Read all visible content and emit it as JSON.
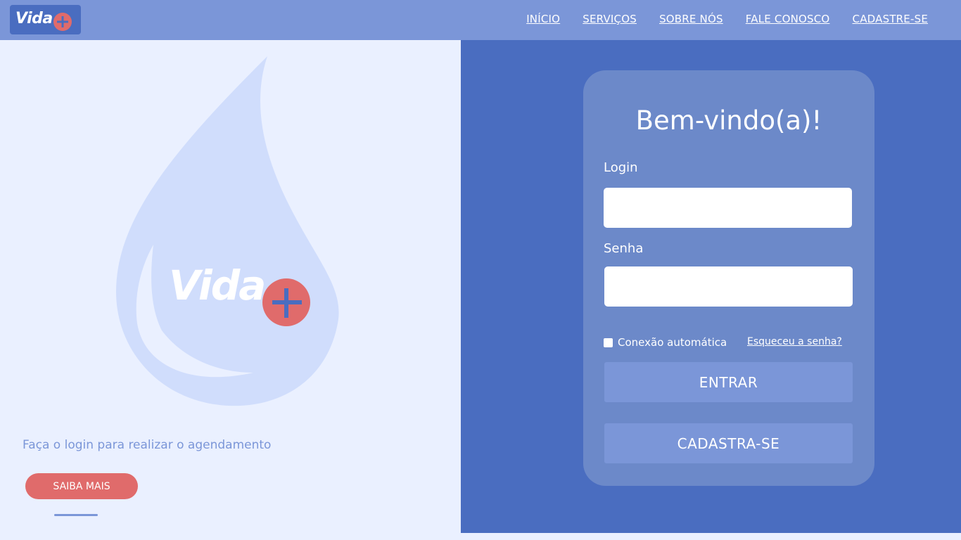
{
  "header": {
    "logo_text": "Vida",
    "nav": [
      "INÍCIO",
      "SERVIÇOS",
      "SOBRE NÓS",
      "FALE CONOSCO",
      "CADASTRE-SE"
    ]
  },
  "hero": {
    "logo_text": "Vida",
    "tagline": "Faça o login para realizar o agendamento",
    "cta_label": "SAIBA MAIS"
  },
  "login": {
    "title": "Bem-vindo(a)!",
    "login_label": "Login",
    "login_value": "",
    "password_label": "Senha",
    "password_value": "",
    "remember_label": "Conexão automática",
    "forgot_label": "Esqueceu a senha?",
    "submit_label": "ENTRAR",
    "signup_label": "CADASTRA-SE"
  },
  "colors": {
    "header": "#7b96d8",
    "primary": "#4a6dc0",
    "card": "#6c89c9",
    "accent": "#e06b6b",
    "background": "#eaf0ff",
    "drop": "#d0ddfc"
  }
}
